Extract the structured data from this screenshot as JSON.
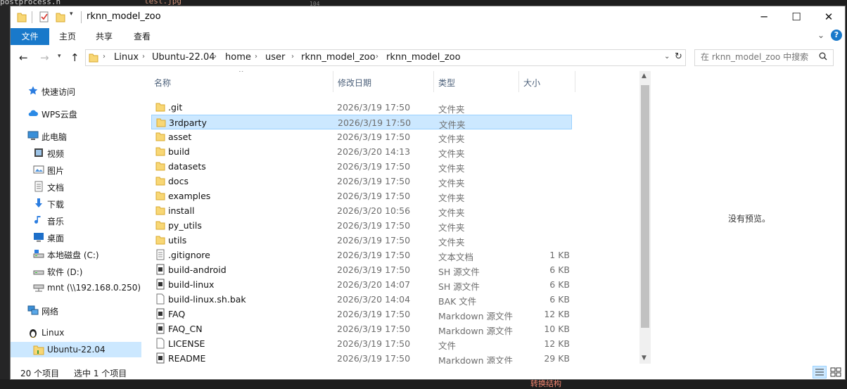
{
  "background": {
    "frag_a": "postprocess.h",
    "frag_b": "test.jpg",
    "frag_c": "104",
    "frag_d": "转换结构"
  },
  "window": {
    "title": "rknn_model_zoo",
    "controls": {
      "minimize": "─",
      "maximize": "☐",
      "close": "✕"
    }
  },
  "ribbon": {
    "tabs": [
      "文件",
      "主页",
      "共享",
      "查看"
    ],
    "help": "?"
  },
  "address": {
    "breadcrumbs": [
      "Linux",
      "Ubuntu-22.04",
      "home",
      "user",
      "rknn_model_zoo",
      "rknn_model_zoo"
    ],
    "search_placeholder": "在 rknn_model_zoo 中搜索"
  },
  "nav_pane": {
    "items": [
      {
        "label": "快速访问",
        "icon": "star-icon"
      },
      {
        "label": "WPS云盘",
        "icon": "cloud-icon"
      },
      {
        "label": "此电脑",
        "icon": "computer-icon"
      },
      {
        "label": "视频",
        "icon": "video-icon"
      },
      {
        "label": "图片",
        "icon": "picture-icon"
      },
      {
        "label": "文档",
        "icon": "document-icon"
      },
      {
        "label": "下载",
        "icon": "download-icon"
      },
      {
        "label": "音乐",
        "icon": "music-icon"
      },
      {
        "label": "桌面",
        "icon": "desktop-icon"
      },
      {
        "label": "本地磁盘 (C:)",
        "icon": "drive-icon"
      },
      {
        "label": "软件 (D:)",
        "icon": "drive-icon"
      },
      {
        "label": "mnt (\\\\192.168.0.250) (",
        "icon": "network-drive-icon"
      },
      {
        "label": "网络",
        "icon": "network-icon"
      },
      {
        "label": "Linux",
        "icon": "linux-icon"
      },
      {
        "label": "Ubuntu-22.04",
        "icon": "folder-icon"
      }
    ]
  },
  "file_list": {
    "columns": [
      "名称",
      "修改日期",
      "类型",
      "大小"
    ],
    "rows": [
      {
        "name": ".git",
        "date": "2026/3/19 17:50",
        "type": "文件夹",
        "size": "",
        "icon": "folder"
      },
      {
        "name": "3rdparty",
        "date": "2026/3/19 17:50",
        "type": "文件夹",
        "size": "",
        "icon": "folder"
      },
      {
        "name": "asset",
        "date": "2026/3/19 17:50",
        "type": "文件夹",
        "size": "",
        "icon": "folder"
      },
      {
        "name": "build",
        "date": "2026/3/20 14:13",
        "type": "文件夹",
        "size": "",
        "icon": "folder"
      },
      {
        "name": "datasets",
        "date": "2026/3/19 17:50",
        "type": "文件夹",
        "size": "",
        "icon": "folder"
      },
      {
        "name": "docs",
        "date": "2026/3/19 17:50",
        "type": "文件夹",
        "size": "",
        "icon": "folder"
      },
      {
        "name": "examples",
        "date": "2026/3/19 17:50",
        "type": "文件夹",
        "size": "",
        "icon": "folder"
      },
      {
        "name": "install",
        "date": "2026/3/20 10:56",
        "type": "文件夹",
        "size": "",
        "icon": "folder"
      },
      {
        "name": "py_utils",
        "date": "2026/3/19 17:50",
        "type": "文件夹",
        "size": "",
        "icon": "folder"
      },
      {
        "name": "utils",
        "date": "2026/3/19 17:50",
        "type": "文件夹",
        "size": "",
        "icon": "folder"
      },
      {
        "name": ".gitignore",
        "date": "2026/3/19 17:50",
        "type": "文本文档",
        "size": "1 KB",
        "icon": "text"
      },
      {
        "name": "build-android",
        "date": "2026/3/19 17:50",
        "type": "SH 源文件",
        "size": "6 KB",
        "icon": "script"
      },
      {
        "name": "build-linux",
        "date": "2026/3/20 14:07",
        "type": "SH 源文件",
        "size": "6 KB",
        "icon": "script"
      },
      {
        "name": "build-linux.sh.bak",
        "date": "2026/3/20 14:04",
        "type": "BAK 文件",
        "size": "6 KB",
        "icon": "file"
      },
      {
        "name": "FAQ",
        "date": "2026/3/19 17:50",
        "type": "Markdown 源文件",
        "size": "12 KB",
        "icon": "script"
      },
      {
        "name": "FAQ_CN",
        "date": "2026/3/19 17:50",
        "type": "Markdown 源文件",
        "size": "10 KB",
        "icon": "script"
      },
      {
        "name": "LICENSE",
        "date": "2026/3/19 17:50",
        "type": "文件",
        "size": "12 KB",
        "icon": "file"
      },
      {
        "name": "README",
        "date": "2026/3/19 17:50",
        "type": "Markdown 源文件",
        "size": "29 KB",
        "icon": "script"
      }
    ]
  },
  "preview": {
    "text": "没有预览。"
  },
  "status": {
    "count": "20 个项目",
    "selected": "选中 1 个项目"
  }
}
